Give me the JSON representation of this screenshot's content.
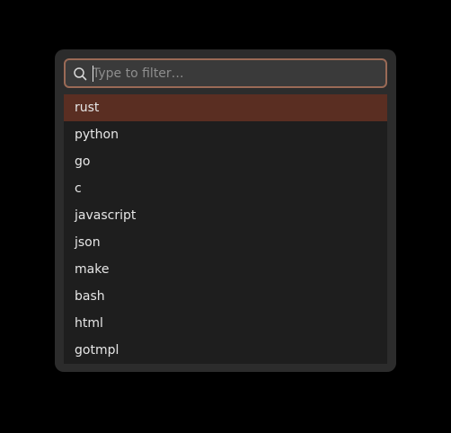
{
  "search": {
    "placeholder": "Type to filter…",
    "value": "",
    "icon": "search-icon"
  },
  "list": {
    "selected_index": 0,
    "items": [
      {
        "label": "rust"
      },
      {
        "label": "python"
      },
      {
        "label": "go"
      },
      {
        "label": "c"
      },
      {
        "label": "javascript"
      },
      {
        "label": "json"
      },
      {
        "label": "make"
      },
      {
        "label": "bash"
      },
      {
        "label": "html"
      },
      {
        "label": "gotmpl"
      }
    ]
  },
  "colors": {
    "background": "#000000",
    "popup": "#2c2c2c",
    "list": "#1e1e1e",
    "selected": "#5a2e22",
    "focus_border": "#9a6a56",
    "text": "#e6e6e6"
  }
}
